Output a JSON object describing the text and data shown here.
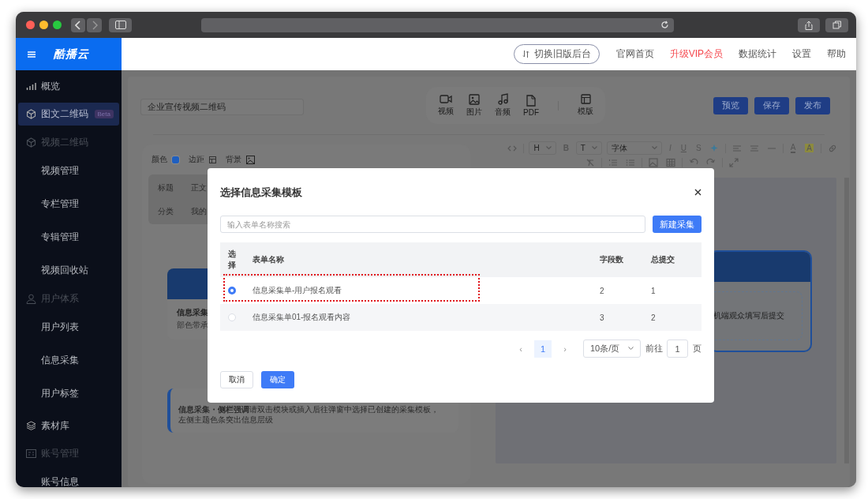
{
  "header": {
    "logo": "酷播云",
    "switch_button": "切换旧版后台",
    "links": [
      {
        "label": "官网首页",
        "kind": "normal"
      },
      {
        "label": "升级VIP会员",
        "kind": "highlight"
      },
      {
        "label": "数据统计",
        "kind": "normal"
      },
      {
        "label": "设置",
        "kind": "normal"
      },
      {
        "label": "帮助",
        "kind": "normal"
      }
    ]
  },
  "sidebar": {
    "items": [
      {
        "label": "概览",
        "selected": false
      },
      {
        "label": "图文二维码",
        "selected": true,
        "badge": "Beta"
      },
      {
        "label": "视频二维码",
        "selected": false,
        "children": [
          {
            "label": "视频管理",
            "selected": false
          },
          {
            "label": "专栏管理",
            "selected": false
          },
          {
            "label": "专辑管理",
            "selected": false
          },
          {
            "label": "视频回收站",
            "selected": false
          }
        ]
      },
      {
        "label": "用户体系",
        "selected": false,
        "children": [
          {
            "label": "用户列表",
            "selected": false
          },
          {
            "label": "信息采集",
            "selected": false
          },
          {
            "label": "用户标签",
            "selected": false
          }
        ]
      },
      {
        "label": "素材库",
        "selected": false
      },
      {
        "label": "账号管理",
        "selected": false,
        "children": [
          {
            "label": "账号信息",
            "selected": false
          }
        ]
      }
    ]
  },
  "editor": {
    "title_field": "企业宣传视频二维码",
    "insert_tools": [
      {
        "label": "视频",
        "kind": "video"
      },
      {
        "label": "图片",
        "kind": "image"
      },
      {
        "label": "音频",
        "kind": "audio"
      },
      {
        "label": "PDF",
        "kind": "pdf"
      },
      {
        "label": "模版",
        "kind": "template"
      }
    ],
    "actions": [
      "预览",
      "保存",
      "发布"
    ],
    "style_bar": {
      "color_label": "颜色",
      "margin_label": "边距",
      "background_label": "背景"
    },
    "block_tabs": [
      "标题",
      "正文",
      "分类",
      "我的"
    ],
    "cards": [
      {
        "kind": "header",
        "title": "信息采集",
        "text": "部色带承"
      },
      {
        "kind": "sidebar",
        "lines": [
          "**信息采集・侧栏强调**请双击模块或插入后往弹窗中选择已创建的采集模板，",
          "左侧主题色条突出信息层级"
        ]
      }
    ],
    "format_bar": {
      "heading": "H",
      "size": "T",
      "font": "字体",
      "marks": [
        "B",
        "I",
        "U",
        "S"
      ],
      "color_marks": [
        "A",
        "A"
      ]
    },
    "preview_text": "机端观众填写后提交"
  },
  "picker": {
    "title": "选择信息采集模板",
    "search_placeholder": "输入表单名称搜索",
    "new_button": "新建采集",
    "columns": [
      "选择",
      "表单名称",
      "字段数",
      "总提交"
    ],
    "rows": [
      {
        "name": "信息采集单-用户报名观看",
        "fields": "2",
        "submissions": "1",
        "selected": true,
        "highlighted": true
      },
      {
        "name": "信息采集单01-报名观看内容",
        "fields": "3",
        "submissions": "2",
        "selected": false,
        "highlighted": false
      }
    ],
    "pagination": {
      "prev": "‹",
      "page": "1",
      "next": "›",
      "page_size": "10条/页",
      "goto_label": "前往",
      "goto_value": "1",
      "unit": "页"
    },
    "cancel": "取消",
    "confirm": "确定"
  }
}
